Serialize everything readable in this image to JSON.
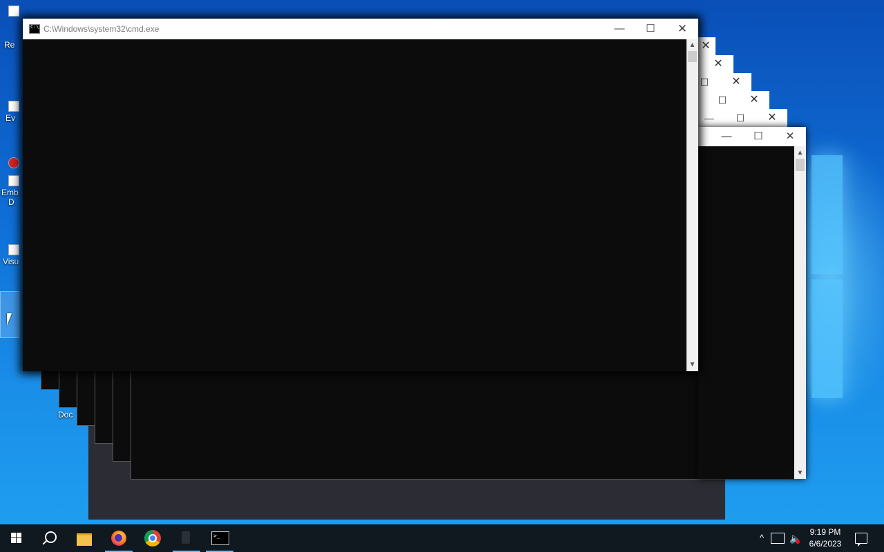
{
  "desktop": {
    "icons": [
      {
        "label": "Re"
      },
      {
        "label": "Ev"
      },
      {
        "label": "Emb"
      },
      {
        "label": "D"
      },
      {
        "label": "Visu"
      }
    ],
    "doc_label": "Doc"
  },
  "cmd_window": {
    "title": "C:\\Windows\\system32\\cmd.exe",
    "minimize": "—",
    "maximize": "☐",
    "close": "✕",
    "scroll_up": "▲",
    "scroll_down": "▼"
  },
  "stack_window": {
    "minimize": "—",
    "maximize": "☐",
    "close": "✕"
  },
  "taskbar": {
    "apps": [
      {
        "name": "start-button"
      },
      {
        "name": "search"
      },
      {
        "name": "file-explorer"
      },
      {
        "name": "firefox"
      },
      {
        "name": "chrome"
      },
      {
        "name": "app-icon"
      },
      {
        "name": "command-prompt"
      }
    ],
    "tray_caret": "^",
    "clock_time": "9:19 PM",
    "clock_date": "6/6/2023"
  },
  "colors": {
    "console_bg": "#0c0c0c",
    "taskbar_bg": "#101820",
    "accent": "#76b9ed"
  }
}
